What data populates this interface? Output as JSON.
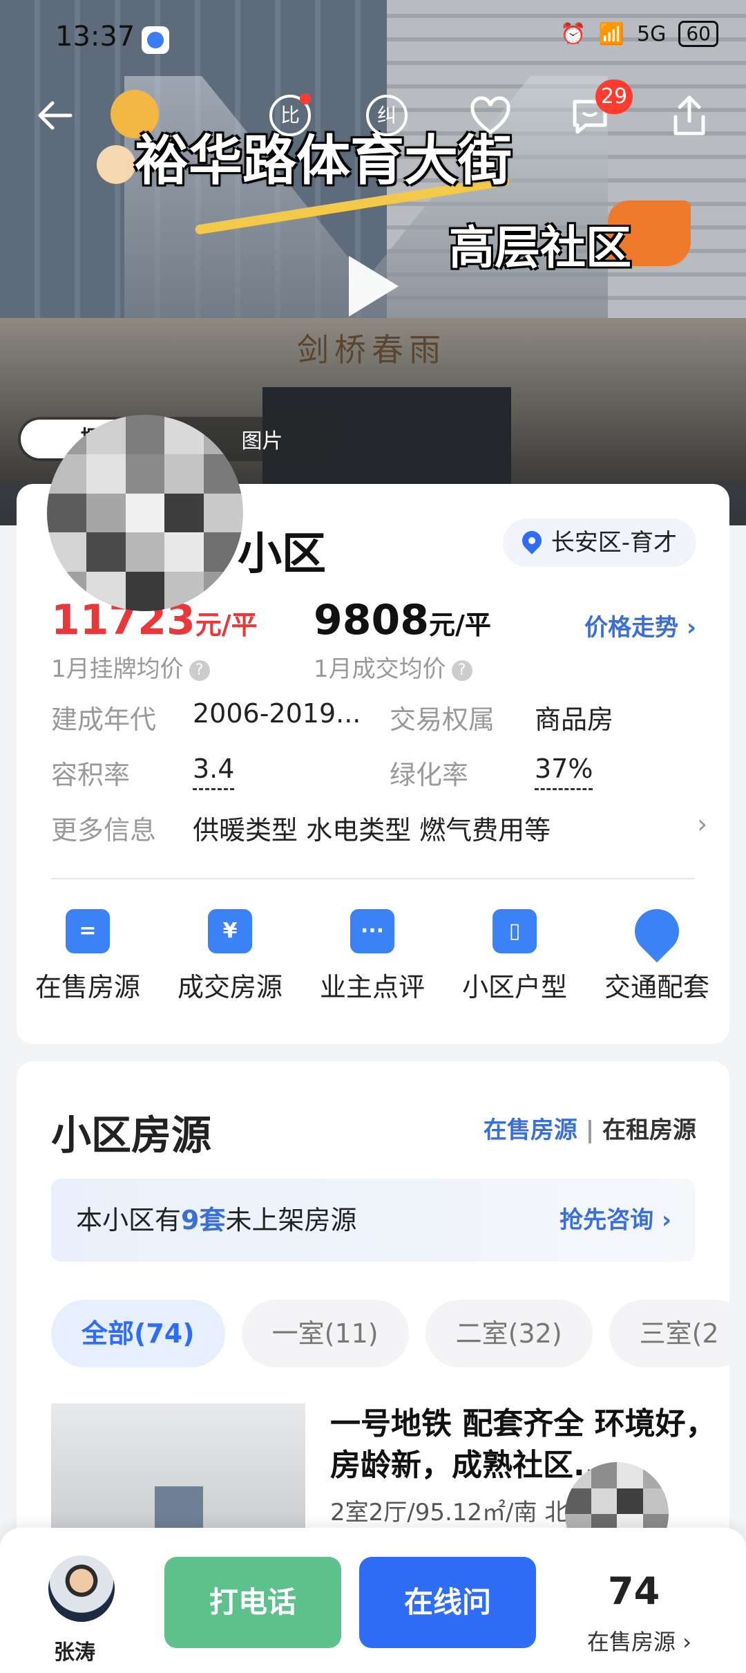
{
  "status_bar": {
    "time": "13:37",
    "network": "5G",
    "battery": "60"
  },
  "hero": {
    "overlay_title": "裕华路体育大街",
    "overlay_subtitle": "高层社区",
    "building_sign": "剑桥春雨",
    "notifications_count": "29",
    "compare_label": "比",
    "correct_label": "纠",
    "media_tabs": [
      "探房",
      "图片"
    ],
    "colors": {
      "accent_yellow": "#f3c94a",
      "accent_orange": "#f07a2b"
    }
  },
  "community": {
    "name_suffix": "小区",
    "district": "长安区-育才",
    "listing_price": "11723",
    "listing_unit": "元/平",
    "listing_label": "1月挂牌均价",
    "deal_price": "9808",
    "deal_unit": "元/平",
    "deal_label": "1月成交均价",
    "trend_link": "价格走势",
    "info": [
      {
        "key": "建成年代",
        "value": "2006-2019..."
      },
      {
        "key": "交易权属",
        "value": "商品房"
      },
      {
        "key": "容积率",
        "value": "3.4"
      },
      {
        "key": "绿化率",
        "value": "37%"
      },
      {
        "key": "更多信息",
        "value": "供暖类型 水电类型 燃气费用等"
      }
    ],
    "nav": [
      {
        "label": "在售房源",
        "icon": "listing-icon"
      },
      {
        "label": "成交房源",
        "icon": "yuan-doc-icon"
      },
      {
        "label": "业主点评",
        "icon": "chat-icon"
      },
      {
        "label": "小区户型",
        "icon": "floorplan-icon"
      },
      {
        "label": "交通配套",
        "icon": "location-icon"
      }
    ]
  },
  "listings": {
    "heading": "小区房源",
    "tab_sale": "在售房源",
    "tab_rent": "在租房源",
    "notice_prefix": "本小区有",
    "notice_count": "9套",
    "notice_suffix": "未上架房源",
    "notice_cta": "抢先咨询",
    "chips": [
      "全部(74)",
      "一室(11)",
      "二室(32)",
      "三室(2"
    ],
    "item": {
      "title": "一号地铁 配套齐全 环境好，房龄新，成熟社区...",
      "subtitle": "2室2厅/95.12㎡/南 北"
    }
  },
  "bottom_bar": {
    "agent_name": "张涛",
    "call_label": "打电话",
    "chat_label": "在线问",
    "count": "74",
    "count_label": "在售房源"
  }
}
